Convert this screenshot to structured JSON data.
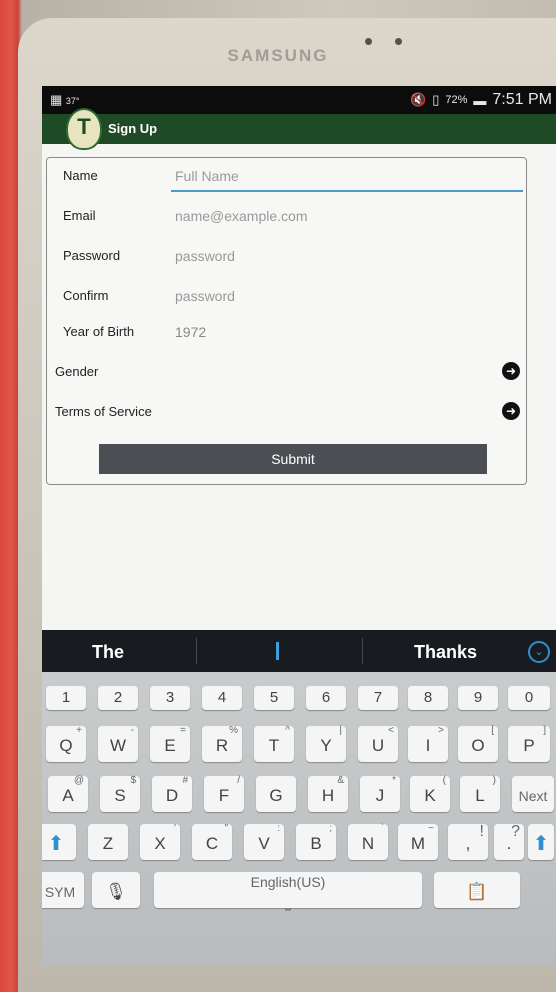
{
  "device": {
    "brand": "SAMSUNG"
  },
  "status_bar": {
    "battery": "72%",
    "time": "7:51 PM",
    "small_text": "37°"
  },
  "app_bar": {
    "logo_letter": "T",
    "title": "Sign Up"
  },
  "form": {
    "name": {
      "label": "Name",
      "placeholder": "Full Name"
    },
    "email": {
      "label": "Email",
      "placeholder": "name@example.com"
    },
    "password": {
      "label": "Password",
      "placeholder": "password"
    },
    "confirm": {
      "label": "Confirm",
      "placeholder": "password"
    },
    "year": {
      "label": "Year of Birth",
      "value": "1972"
    },
    "gender": {
      "label": "Gender"
    },
    "terms": {
      "label": "Terms of Service"
    },
    "submit_label": "Submit"
  },
  "suggestions": [
    "The",
    "I",
    "Thanks"
  ],
  "keyboard": {
    "numbers": [
      "1",
      "2",
      "3",
      "4",
      "5",
      "6",
      "7",
      "8",
      "9",
      "0"
    ],
    "row1": [
      [
        "Q",
        "+"
      ],
      [
        "W",
        "-"
      ],
      [
        "E",
        "="
      ],
      [
        "R",
        "%"
      ],
      [
        "T",
        "^"
      ],
      [
        "Y",
        "|"
      ],
      [
        "U",
        "<"
      ],
      [
        "I",
        ">"
      ],
      [
        "O",
        "["
      ],
      [
        "P",
        "]"
      ]
    ],
    "row2": [
      [
        "A",
        "@"
      ],
      [
        "S",
        "$"
      ],
      [
        "D",
        "#"
      ],
      [
        "F",
        "/"
      ],
      [
        "G",
        ""
      ],
      [
        "H",
        "&"
      ],
      [
        "J",
        "*"
      ],
      [
        "K",
        "("
      ],
      [
        "L",
        ")"
      ]
    ],
    "row3": [
      [
        "Z",
        ""
      ],
      [
        "X",
        "'"
      ],
      [
        "C",
        "\""
      ],
      [
        "V",
        ":"
      ],
      [
        "B",
        ";"
      ],
      [
        "N",
        "`"
      ],
      [
        "M",
        "~"
      ]
    ],
    "punct1": "!",
    "punct1_main": ",",
    "punct2": "?",
    "punct2_main": ".",
    "next_label": "Next",
    "sym_label": "SYM",
    "space_label": "English(US)"
  }
}
